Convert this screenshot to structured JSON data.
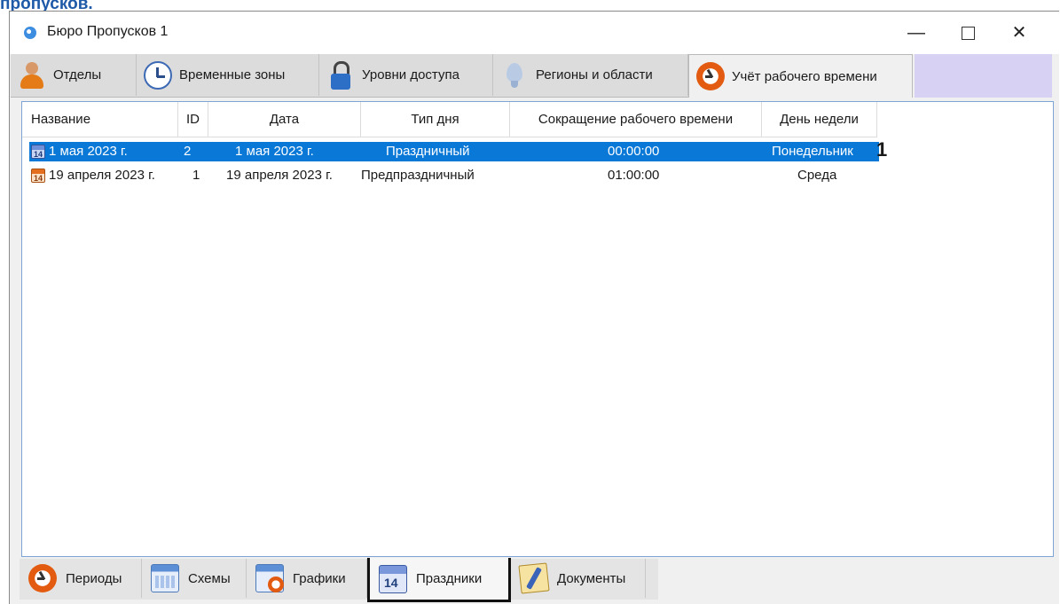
{
  "caption": "пропусков.",
  "window": {
    "title": "Бюро Пропусков 1",
    "controls": {
      "minimize": "—",
      "maximize": "",
      "close": "✕"
    }
  },
  "top_tabs": [
    {
      "label": "Отделы",
      "icon": "person-icon"
    },
    {
      "label": "Временные зоны",
      "icon": "clock-icon"
    },
    {
      "label": "Уровни доступа",
      "icon": "lock-icon"
    },
    {
      "label": "Регионы и области",
      "icon": "region-icon"
    },
    {
      "label": "Учёт рабочего времени",
      "icon": "worktime-icon",
      "active": true
    }
  ],
  "table": {
    "columns": [
      "Название",
      "ID",
      "Дата",
      "Тип дня",
      "Сокращение рабочего времени",
      "День недели"
    ],
    "rows": [
      {
        "name": "1 мая 2023 г.",
        "id": "2",
        "date": "1 мая 2023 г.",
        "day_type": "Праздничный",
        "reduction": "00:00:00",
        "weekday": "Понедельник",
        "icon": "calendar-blue-icon",
        "selected": true
      },
      {
        "name": "19 апреля 2023 г.",
        "id": "1",
        "date": "19 апреля 2023 г.",
        "day_type": "Предпраздничный",
        "reduction": "01:00:00",
        "weekday": "Среда",
        "icon": "calendar-orange-icon",
        "selected": false
      }
    ],
    "marker": "1"
  },
  "bottom_tabs": [
    {
      "label": "Периоды",
      "icon": "worktime-icon"
    },
    {
      "label": "Схемы",
      "icon": "schema-icon"
    },
    {
      "label": "Графики",
      "icon": "graph-icon"
    },
    {
      "label": "Праздники",
      "icon": "holiday-icon",
      "active": true
    },
    {
      "label": "Документы",
      "icon": "documents-icon"
    }
  ],
  "colors": {
    "selection": "#0a78d7",
    "tab_filler": "#d7d2f4",
    "highlight_border": "#111111"
  }
}
